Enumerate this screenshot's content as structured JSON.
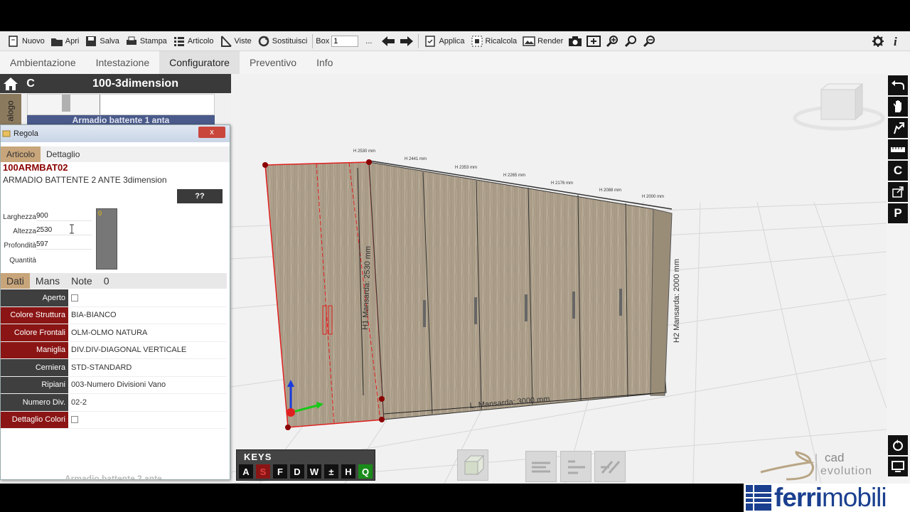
{
  "toolbar": {
    "nuovo": "Nuovo",
    "apri": "Apri",
    "salva": "Salva",
    "stampa": "Stampa",
    "articolo": "Articolo",
    "viste": "Viste",
    "sostituisci": "Sostituisci",
    "box_label": "Box",
    "box_value": "1",
    "more": "...",
    "applica": "Applica",
    "ricalcola": "Ricalcola",
    "render": "Render"
  },
  "menu_tabs": [
    "Ambientazione",
    "Intestazione",
    "Configuratore",
    "Preventivo",
    "Info"
  ],
  "left_panel": {
    "c_label": "C",
    "title": "100-3dimension",
    "catalog_side": "alogo",
    "catalog_item": "Armadio battente 1 anta"
  },
  "regola": {
    "title": "Regola",
    "close": "x",
    "tabs": [
      "Articolo",
      "Dettaglio"
    ],
    "code": "100ARMBAT02",
    "description": "ARMADIO BATTENTE 2 ANTE 3dimension",
    "qq_button": "??",
    "dims": {
      "larghezza_label": "Larghezza",
      "larghezza": "900",
      "altezza_label": "Altezza",
      "altezza": "2530",
      "profondita_label": "Profondità",
      "profondita": "597",
      "quantita_label": "Quantità"
    },
    "preview_marker": "0",
    "subtabs": [
      "Dati",
      "Mans",
      "Note",
      "0"
    ],
    "props": [
      {
        "label": "Aperto",
        "value": "",
        "checkbox": true,
        "red": false
      },
      {
        "label": "Colore Struttura",
        "value": "BIA-BIANCO",
        "checkbox": false,
        "red": true
      },
      {
        "label": "Colore Frontali",
        "value": "OLM-OLMO NATURA",
        "checkbox": false,
        "red": true
      },
      {
        "label": "Maniglia",
        "value": "DIV.DIV-DIAGONAL VERTICALE",
        "checkbox": false,
        "red": true
      },
      {
        "label": "Cerniera",
        "value": "STD-STANDARD",
        "checkbox": false,
        "red": false
      },
      {
        "label": "Ripiani",
        "value": "003-Numero Divisioni Vano",
        "checkbox": false,
        "red": false
      },
      {
        "label": "Numero Div.",
        "value": "02-2",
        "checkbox": false,
        "red": false
      },
      {
        "label": "Dettaglio Colori",
        "value": "",
        "checkbox": true,
        "red": true
      }
    ],
    "bottom_ghost": "Armadio battente 2 ante"
  },
  "viewport": {
    "top_dims": [
      "H 2530 mm",
      "H 2441 mm",
      "H 2353 mm",
      "H 2265 mm",
      "H 2176 mm",
      "H 2088 mm",
      "H 2000 mm"
    ],
    "h1_label": "H1 Mansarda: 2530 mm",
    "h2_label": "H2 Mansarda: 2000 mm",
    "l_label": "L. Mansarda: 3000 mm"
  },
  "keys": {
    "title": "KEYS",
    "items": [
      "A",
      "S",
      "F",
      "D",
      "W",
      "±",
      "H",
      "Q"
    ]
  },
  "right_tools": [
    "C",
    "P"
  ],
  "branding": {
    "cad": "cad",
    "evolution": "evolution",
    "ferri_a": "ferri",
    "ferri_b": "mobili"
  },
  "colors": {
    "accent_tan": "#c8a57a",
    "prop_red": "#8b1515",
    "ferri_blue": "#1a3f8f",
    "selection_red": "#e02020"
  }
}
